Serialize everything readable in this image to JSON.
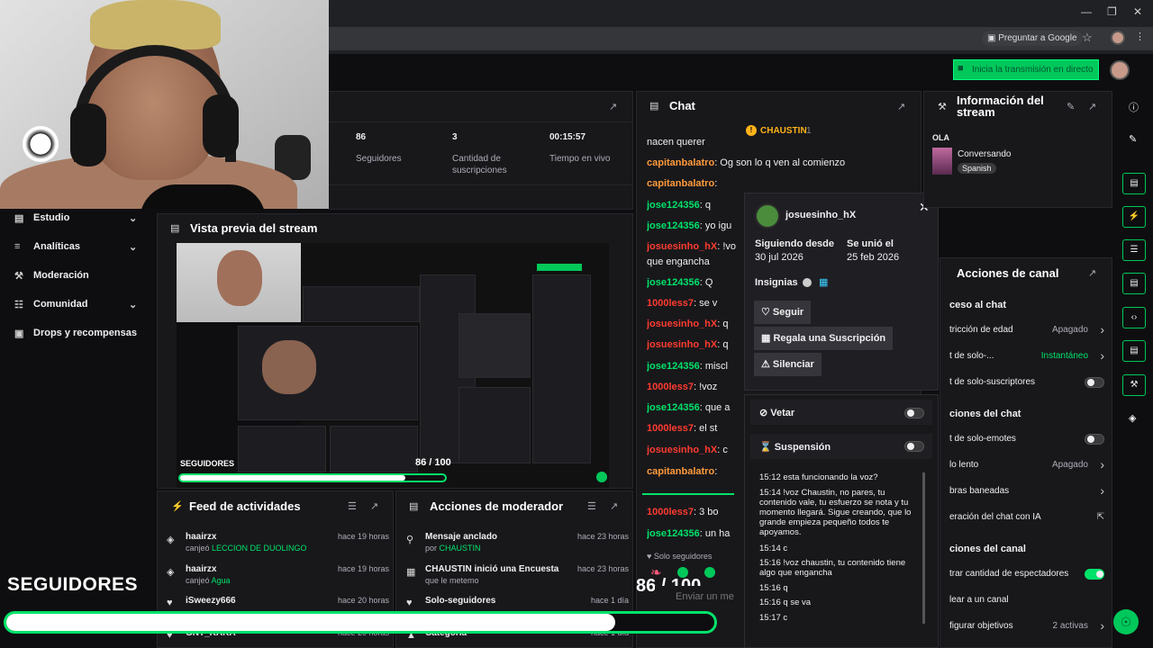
{
  "browser": {
    "ask_google": "Preguntar a Google"
  },
  "header": {
    "go_live": "Inicia la transmisión en directo"
  },
  "stats": [
    {
      "value": "86",
      "label": "Seguidores"
    },
    {
      "value": "3",
      "label": "Cantidad de suscripciones"
    },
    {
      "value": "00:15:57",
      "label": "Tiempo en vivo"
    }
  ],
  "nav": [
    {
      "label": "Estudio"
    },
    {
      "label": "Analíticas"
    },
    {
      "label": "Moderación"
    },
    {
      "label": "Comunidad"
    },
    {
      "label": "Drops y recompensas"
    }
  ],
  "preview": {
    "title": "Vista previa del stream",
    "followers_label": "SEGUIDORES",
    "followers_count": "86 / 100"
  },
  "feed": {
    "title": "Feed de actividades",
    "items": [
      {
        "name": "haairzx",
        "action": "canjeó ",
        "reward": "LECCION DE DUOLINGO",
        "time": "hace 19 horas"
      },
      {
        "name": "haairzx",
        "action": "canjeó ",
        "reward": "Agua",
        "time": "hace 19 horas"
      },
      {
        "name": "iSweezy666",
        "action": "",
        "reward": "",
        "time": "hace 20 horas"
      },
      {
        "name": "GNT_KAKA",
        "action": "",
        "reward": "",
        "time": "hace 20 horas"
      }
    ]
  },
  "modactions": {
    "title": "Acciones de moderador",
    "items": [
      {
        "name": "Mensaje anclado",
        "by": "por ",
        "who": "CHAUSTIN",
        "time": "hace 23 horas"
      },
      {
        "name": "CHAUSTIN inició una Encuesta",
        "by": "que le metemo",
        "who": "",
        "time": "hace 23 horas"
      },
      {
        "name": "Solo-seguidores",
        "by": "",
        "who": "",
        "time": "hace 1 día"
      },
      {
        "name": "Categoría",
        "by": "",
        "who": "",
        "time": "hace 1 día"
      }
    ]
  },
  "chat": {
    "title": "Chat",
    "pinned_user": "CHAUSTIN",
    "pinned_count": "1",
    "lines": [
      {
        "user": "",
        "msg": "nacen querer",
        "color": "#efeff1"
      },
      {
        "user": "capitanbalatro",
        "msg": ": Og son lo q ven al comienzo",
        "color": "#ff9a3c",
        "wide": true
      },
      {
        "user": "capitanbalatro",
        "msg": ":",
        "color": "#ff9a3c"
      },
      {
        "user": "jose124356",
        "msg": ": q",
        "color": "#00e36a"
      },
      {
        "user": "jose124356",
        "msg": ": yo igu",
        "color": "#00e36a"
      },
      {
        "user": "josuesinho_hX",
        "msg": ": !vo",
        "color": "#ff3b30"
      },
      {
        "user": "",
        "msg": "que engancha",
        "color": "#efeff1"
      },
      {
        "user": "jose124356",
        "msg": ": Q",
        "color": "#00e36a"
      },
      {
        "user": "1000less7",
        "msg": ": se v",
        "color": "#ff3b30"
      },
      {
        "user": "josuesinho_hX",
        "msg": ": q",
        "color": "#ff3b30"
      },
      {
        "user": "josuesinho_hX",
        "msg": ": q",
        "color": "#ff3b30"
      },
      {
        "user": "jose124356",
        "msg": ": miscl",
        "color": "#00e36a"
      },
      {
        "user": "1000less7",
        "msg": ": !voz",
        "color": "#ff3b30"
      },
      {
        "user": "jose124356",
        "msg": ": que a",
        "color": "#00e36a"
      },
      {
        "user": "1000less7",
        "msg": ": el st",
        "color": "#ff3b30"
      },
      {
        "user": "josuesinho_hX",
        "msg": ": c",
        "color": "#ff3b30"
      },
      {
        "user": "capitanbalatro",
        "msg": ":",
        "color": "#ff9a3c"
      },
      {
        "user": "1000less7",
        "msg": ": 3 bo",
        "color": "#ff3b30"
      },
      {
        "user": "jose124356",
        "msg": ": un ha",
        "color": "#00e36a"
      }
    ],
    "followers_only": "Solo seguidores",
    "input_placeholder": "Enviar un me",
    "count": "86 / 100",
    "viewers": "∞",
    "points": "0"
  },
  "usercard": {
    "username": "josuesinho_hX",
    "following_label": "Siguiendo desde",
    "following_date": "30 jul 2026",
    "joined_label": "Se unió el",
    "joined_date": "25 feb 2026",
    "badges_label": "Insignias",
    "follow": "Seguir",
    "gift": "Regala una Suscripción",
    "mute": "Silenciar",
    "ban": "Vetar",
    "timeout": "Suspensión",
    "log": [
      "15:12 esta funcionando la voz?",
      "15:14 !voz Chaustin, no pares, tu contenido vale, tu esfuerzo se nota y tu momento llegará. Sigue creando, que lo grande empieza pequeño todos te apoyamos.",
      "15:14 c",
      "15:16 !voz chaustin, tu contenido tiene algo que engancha",
      "15:16 q",
      "15:16 q se va",
      "15:17 c"
    ]
  },
  "streaminfo": {
    "title": "Información del stream",
    "stream_title": "OLA",
    "category": "Conversando",
    "language": "Spanish"
  },
  "channel": {
    "title": "Acciones de canal",
    "rows": [
      {
        "label": "ceso al chat",
        "value": "",
        "kind": "section"
      },
      {
        "label": "tricción de edad",
        "value": "Apagado",
        "kind": "arrow"
      },
      {
        "label": "t de solo-...",
        "value": "Instantáneo",
        "kind": "arrow",
        "green": true
      },
      {
        "label": "t de solo-suscriptores",
        "value": "",
        "kind": "toggle"
      },
      {
        "label": "ciones del chat",
        "value": "",
        "kind": "section"
      },
      {
        "label": "t de solo-emotes",
        "value": "",
        "kind": "toggle"
      },
      {
        "label": "lo lento",
        "value": "Apagado",
        "kind": "arrow"
      },
      {
        "label": "bras baneadas",
        "value": "",
        "kind": "arrow"
      },
      {
        "label": "eración del chat con IA",
        "value": "",
        "kind": "ext"
      },
      {
        "label": "ciones del canal",
        "value": "",
        "kind": "section"
      },
      {
        "label": "trar cantidad de espectadores",
        "value": "",
        "kind": "toggle-on"
      },
      {
        "label": "lear a un canal",
        "value": "",
        "kind": "none"
      },
      {
        "label": "figurar objetivos",
        "value": "2 activas",
        "kind": "arrow"
      }
    ]
  },
  "overlay": {
    "label": "SEGUIDORES",
    "count": "86 / 100",
    "progress": 0.86
  }
}
